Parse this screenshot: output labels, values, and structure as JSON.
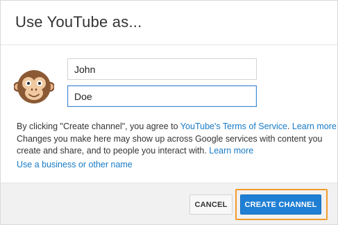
{
  "dialog": {
    "title": "Use YouTube as..."
  },
  "form": {
    "first_name_value": "John",
    "last_name_value": "Doe"
  },
  "legal": {
    "line1_prefix": "By clicking \"Create channel\", you agree to ",
    "tos_link": "YouTube's Terms of Service",
    "line1_learn_more": "Learn more",
    "line2_text": "Changes you make here may show up across Google services with content you create and share, and to people you interact with. ",
    "line2_learn_more": "Learn more",
    "business_link": "Use a business or other name"
  },
  "buttons": {
    "cancel_label": "CANCEL",
    "create_label": "CREATE CHANNEL"
  },
  "colors": {
    "link": "#167ac6",
    "primary_button": "#1f7fd4",
    "highlight": "#f39b2b"
  },
  "avatar": {
    "icon": "monkey-avatar-icon"
  }
}
